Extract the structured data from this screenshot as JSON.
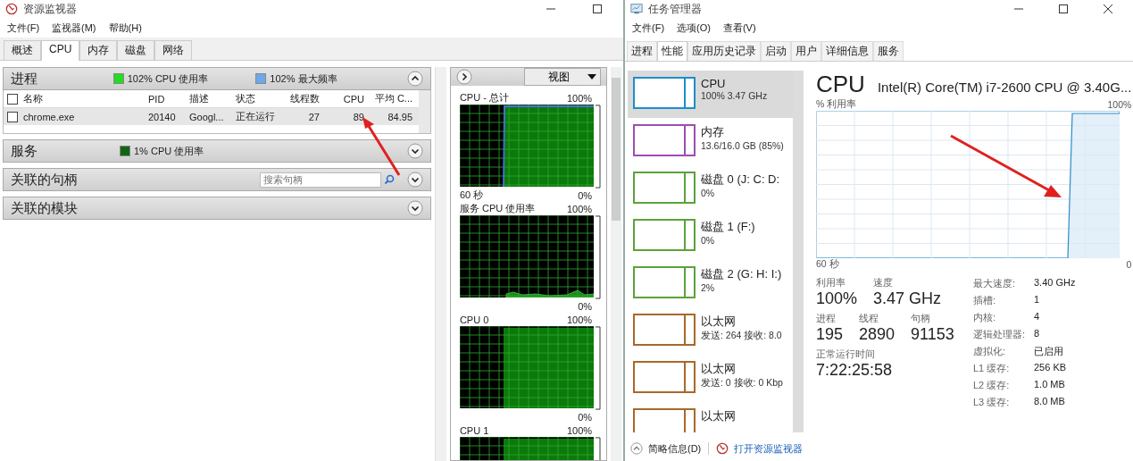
{
  "resource_monitor": {
    "title": "资源监视器",
    "menu": [
      "文件(F)",
      "监视器(M)",
      "帮助(H)"
    ],
    "tabs": [
      {
        "label": "概述",
        "selected": false
      },
      {
        "label": "CPU",
        "selected": true
      },
      {
        "label": "内存",
        "selected": false
      },
      {
        "label": "磁盘",
        "selected": false
      },
      {
        "label": "网络",
        "selected": false
      }
    ],
    "sections": [
      {
        "title": "进程",
        "expanded": true,
        "legend": [
          {
            "color": "#22dd22",
            "text": "102% CPU 使用率"
          },
          {
            "color": "#6fa8e8",
            "text": "102% 最大频率"
          }
        ],
        "table": {
          "all_checked": false,
          "columns": [
            "名称",
            "PID",
            "描述",
            "状态",
            "线程数",
            "CPU",
            "平均 C..."
          ],
          "rows": [
            {
              "checked": false,
              "cells": [
                "chrome.exe",
                "20140",
                "Googl...",
                "正在运行",
                "27",
                "89",
                "84.95"
              ]
            }
          ]
        }
      },
      {
        "title": "服务",
        "expanded": false,
        "legend": [
          {
            "color": "#116611",
            "text": "1% CPU 使用率"
          }
        ]
      },
      {
        "title": "关联的句柄",
        "expanded": false,
        "search": {
          "placeholder": "搜索句柄"
        }
      },
      {
        "title": "关联的模块",
        "expanded": false
      }
    ],
    "view_button": "视图",
    "graphs": [
      {
        "kind": "busy",
        "title": "CPU - 总计",
        "max": "100%",
        "time": "60 秒",
        "min": "0%",
        "limit_line": true
      },
      {
        "kind": "idle",
        "title": "服务 CPU 使用率",
        "max": "100%",
        "min": "0%",
        "limit_line": false
      },
      {
        "kind": "busy",
        "title": "CPU 0",
        "max": "100%",
        "min": "0%",
        "limit_line": false
      },
      {
        "kind": "busy",
        "title": "CPU 1",
        "max": "100%",
        "limit_line": false
      }
    ]
  },
  "task_manager": {
    "title": "任务管理器",
    "menu": [
      "文件(F)",
      "选项(O)",
      "查看(V)"
    ],
    "tabs": [
      {
        "label": "进程",
        "selected": false
      },
      {
        "label": "性能",
        "selected": true
      },
      {
        "label": "应用历史记录",
        "selected": false
      },
      {
        "label": "启动",
        "selected": false
      },
      {
        "label": "用户",
        "selected": false
      },
      {
        "label": "详细信息",
        "selected": false
      },
      {
        "label": "服务",
        "selected": false
      }
    ],
    "devices": [
      {
        "name": "CPU",
        "detail": "100% 3.47 GHz",
        "selected": true,
        "color": "#1b8fc9"
      },
      {
        "name": "内存",
        "detail": "13.6/16.0 GB (85%)",
        "selected": false,
        "color": "#9b4fb0"
      },
      {
        "name": "磁盘 0 (J: C: D:",
        "detail": "0%",
        "selected": false,
        "color": "#5aa33a"
      },
      {
        "name": "磁盘 1 (F:)",
        "detail": "0%",
        "selected": false,
        "color": "#5aa33a"
      },
      {
        "name": "磁盘 2 (G: H: I:)",
        "detail": "2%",
        "selected": false,
        "color": "#5aa33a"
      },
      {
        "name": "以太网",
        "detail": "发送: 264 接收: 8.0",
        "selected": false,
        "color": "#a8682a"
      },
      {
        "name": "以太网",
        "detail": "发送: 0 接收: 0 Kbp",
        "selected": false,
        "color": "#a8682a"
      },
      {
        "name": "以太网",
        "selected": false,
        "color": "#a8682a"
      }
    ],
    "heading": "CPU",
    "model": "Intel(R) Core(TM) i7-2600 CPU @ 3.40G...",
    "graph": {
      "ylabel": "% 利用率",
      "max": "100%",
      "time": "60 秒",
      "min": "0"
    },
    "stats": [
      [
        {
          "label": "利用率",
          "value": "100%"
        },
        {
          "label": "速度",
          "value": "3.47 GHz"
        }
      ],
      [
        {
          "label": "进程",
          "value": "195"
        },
        {
          "label": "线程",
          "value": "2890"
        },
        {
          "label": "句柄",
          "value": "91153"
        }
      ],
      [
        {
          "label": "正常运行时间",
          "value": "7:22:25:58"
        }
      ]
    ],
    "specs": [
      {
        "label": "最大速度:",
        "value": "3.40 GHz"
      },
      {
        "label": "插槽:",
        "value": "1"
      },
      {
        "label": "内核:",
        "value": "4"
      },
      {
        "label": "逻辑处理器:",
        "value": "8"
      },
      {
        "label": "虚拟化:",
        "value": "已启用"
      },
      {
        "label": "L1 缓存:",
        "value": "256 KB"
      },
      {
        "label": "L2 缓存:",
        "value": "1.0 MB"
      },
      {
        "label": "L3 缓存:",
        "value": "8.0 MB"
      }
    ],
    "footer": {
      "less_details": "简略信息(D)",
      "open_monitor": "打开资源监视器"
    }
  }
}
